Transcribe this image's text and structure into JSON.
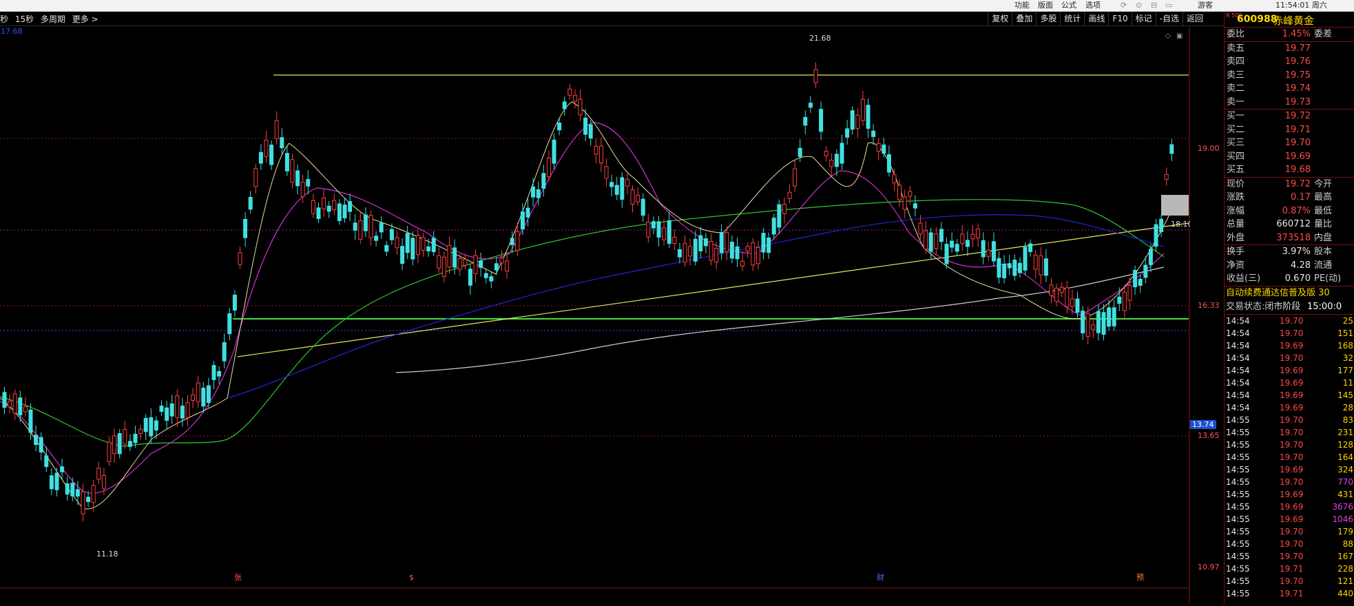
{
  "topbar": {
    "items": [
      "功能",
      "版面",
      "公式",
      "选项",
      "游客",
      "11:54:01 周六"
    ]
  },
  "toolbar": {
    "left": [
      "秒",
      "15秒",
      "多周期",
      "更多 >"
    ],
    "right": [
      "复权",
      "叠加",
      "多股",
      "统计",
      "画线",
      "F10",
      "标记",
      "-自选",
      "返回"
    ]
  },
  "chart": {
    "price_labels": [
      "21.68",
      "11.18",
      "18.10"
    ],
    "axis": [
      "19.00",
      "16.33",
      "13.74",
      "13.65",
      "10.97"
    ],
    "corner_label": "17.68",
    "markers": [
      "张",
      "$",
      "财",
      "预"
    ]
  },
  "chart_data": {
    "type": "candlestick",
    "high_marker": 21.68,
    "low_marker": 11.18,
    "last_marker": 18.1,
    "ylim": [
      10.97,
      22.2
    ]
  },
  "side": {
    "badge": "R 500",
    "code": "600988",
    "name": "赤峰黄金",
    "weibi": {
      "k": "委比",
      "v": "1.45%",
      "k2": "委差"
    },
    "sell": [
      {
        "k": "卖五",
        "v": "19.77"
      },
      {
        "k": "卖四",
        "v": "19.76"
      },
      {
        "k": "卖三",
        "v": "19.75"
      },
      {
        "k": "卖二",
        "v": "19.74"
      },
      {
        "k": "卖一",
        "v": "19.73"
      }
    ],
    "buy": [
      {
        "k": "买一",
        "v": "19.72"
      },
      {
        "k": "买二",
        "v": "19.71"
      },
      {
        "k": "买三",
        "v": "19.70"
      },
      {
        "k": "买四",
        "v": "19.69"
      },
      {
        "k": "买五",
        "v": "19.68"
      }
    ],
    "quote": [
      {
        "k": "现价",
        "v": "19.72",
        "k2": "今开"
      },
      {
        "k": "涨跌",
        "v": "0.17",
        "k2": "最高"
      },
      {
        "k": "涨幅",
        "v": "0.87%",
        "k2": "最低"
      },
      {
        "k": "总量",
        "v": "660712",
        "k2": "量比",
        "white": true
      },
      {
        "k": "外盘",
        "v": "373518",
        "k2": "内盘"
      }
    ],
    "stats": [
      {
        "k": "换手",
        "v": "3.97%",
        "k2": "股本",
        "white": true
      },
      {
        "k": "净资",
        "v": "4.28",
        "k2": "流通",
        "white": true
      },
      {
        "k": "收益(三)",
        "v": "0.670",
        "k2": "PE(动)",
        "white": true
      }
    ],
    "banner": "自动续费通达信普及版  30",
    "state_k": "交易状态:",
    "state_v": "闭市阶段",
    "state_t": "15:00:0",
    "ticks": [
      {
        "t": "14:54",
        "p": "19.70",
        "q": "25"
      },
      {
        "t": "14:54",
        "p": "19.70",
        "q": "151"
      },
      {
        "t": "14:54",
        "p": "19.69",
        "q": "168"
      },
      {
        "t": "14:54",
        "p": "19.70",
        "q": "32"
      },
      {
        "t": "14:54",
        "p": "19.69",
        "q": "177"
      },
      {
        "t": "14:54",
        "p": "19.69",
        "q": "11"
      },
      {
        "t": "14:54",
        "p": "19.69",
        "q": "145"
      },
      {
        "t": "14:54",
        "p": "19.69",
        "q": "28"
      },
      {
        "t": "14:55",
        "p": "19.70",
        "q": "83"
      },
      {
        "t": "14:55",
        "p": "19.70",
        "q": "231"
      },
      {
        "t": "14:55",
        "p": "19.70",
        "q": "128"
      },
      {
        "t": "14:55",
        "p": "19.70",
        "q": "164"
      },
      {
        "t": "14:55",
        "p": "19.69",
        "q": "324"
      },
      {
        "t": "14:55",
        "p": "19.70",
        "q": "770",
        "pur": true
      },
      {
        "t": "14:55",
        "p": "19.69",
        "q": "431"
      },
      {
        "t": "14:55",
        "p": "19.69",
        "q": "3676",
        "pur": true
      },
      {
        "t": "14:55",
        "p": "19.69",
        "q": "1046",
        "pur": true
      },
      {
        "t": "14:55",
        "p": "19.70",
        "q": "179"
      },
      {
        "t": "14:55",
        "p": "19.70",
        "q": "88"
      },
      {
        "t": "14:55",
        "p": "19.70",
        "q": "167"
      },
      {
        "t": "14:55",
        "p": "19.71",
        "q": "228"
      },
      {
        "t": "14:55",
        "p": "19.70",
        "q": "121"
      },
      {
        "t": "14:55",
        "p": "19.71",
        "q": "440"
      }
    ]
  }
}
